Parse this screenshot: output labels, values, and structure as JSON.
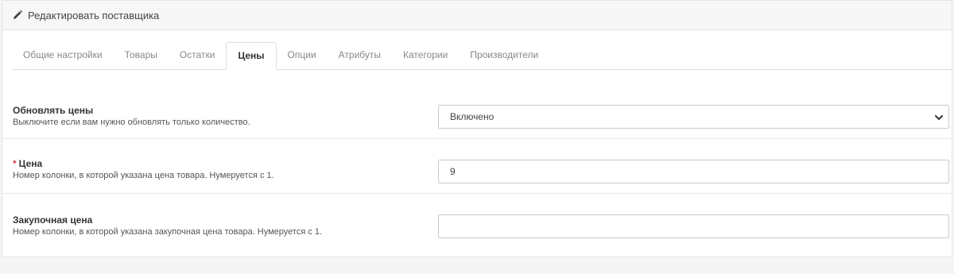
{
  "panel": {
    "title": "Редактировать поставщика",
    "icon": "pencil-icon"
  },
  "tabs": [
    {
      "label": "Общие настройки",
      "active": false
    },
    {
      "label": "Товары",
      "active": false
    },
    {
      "label": "Остатки",
      "active": false
    },
    {
      "label": "Цены",
      "active": true
    },
    {
      "label": "Опции",
      "active": false
    },
    {
      "label": "Атрибуты",
      "active": false
    },
    {
      "label": "Категории",
      "active": false
    },
    {
      "label": "Производители",
      "active": false
    }
  ],
  "form": {
    "update_prices": {
      "label": "Обновлять цены",
      "help": "Выключите если вам нужно обновлять только количество.",
      "value": "Включено"
    },
    "price": {
      "required_mark": "*",
      "label": "Цена",
      "help": "Номер колонки, в которой указана цена товара. Нумеруется с 1.",
      "value": "9"
    },
    "purchase_price": {
      "label": "Закупочная цена",
      "help": "Номер колонки, в которой указана закупочная цена товара. Нумеруется с 1.",
      "value": ""
    }
  },
  "colors": {
    "background": "#f5f5f5",
    "panel": "#ffffff",
    "required": "#e03e3e",
    "border": "#c9c9c9"
  }
}
